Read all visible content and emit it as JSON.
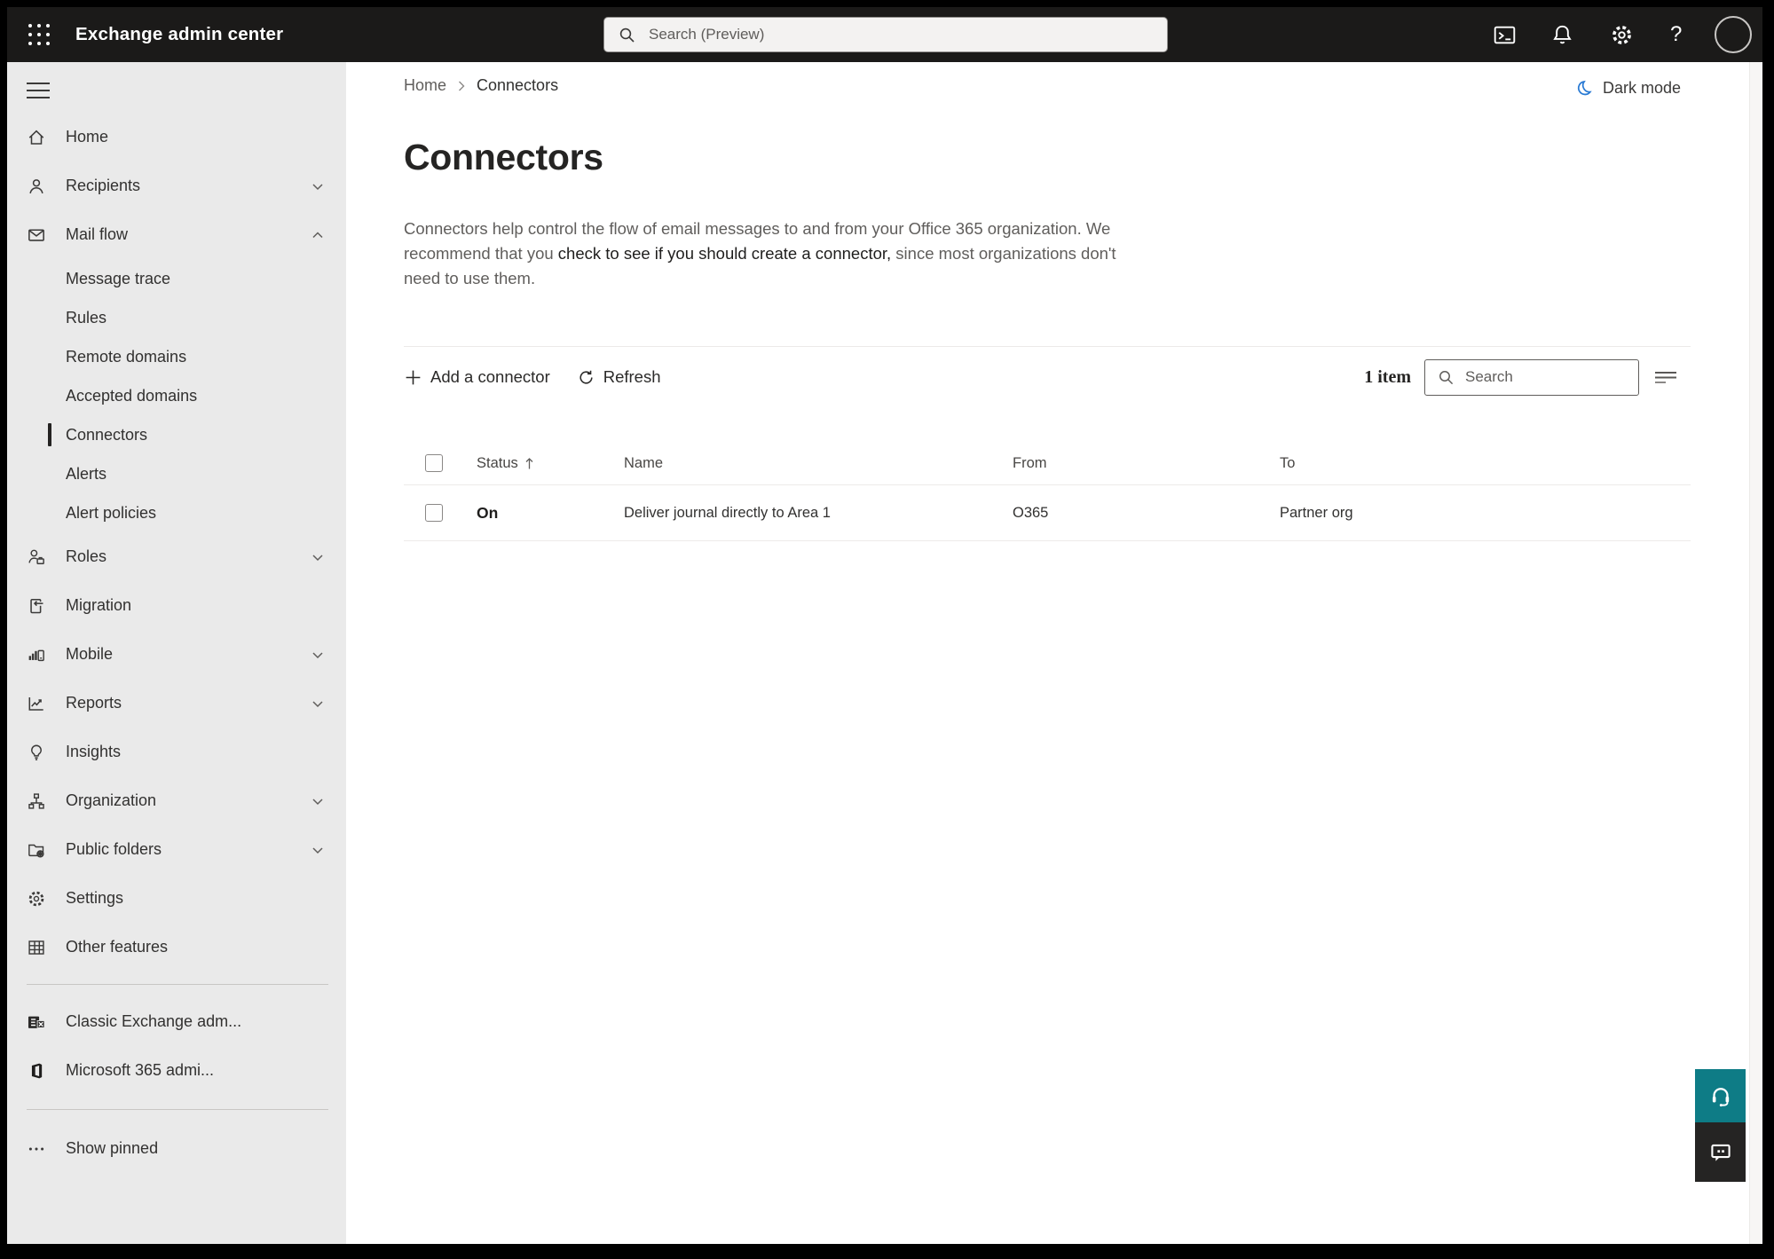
{
  "topbar": {
    "title": "Exchange admin center",
    "search_placeholder": "Search (Preview)"
  },
  "sidebar": {
    "items": [
      {
        "label": "Home",
        "icon": "home"
      },
      {
        "label": "Recipients",
        "icon": "recipients",
        "chevron": "down"
      },
      {
        "label": "Mail flow",
        "icon": "mail-flow",
        "chevron": "up"
      },
      {
        "label": "Message trace",
        "sub": true
      },
      {
        "label": "Rules",
        "sub": true
      },
      {
        "label": "Remote domains",
        "sub": true
      },
      {
        "label": "Accepted domains",
        "sub": true
      },
      {
        "label": "Connectors",
        "sub": true,
        "selected": true
      },
      {
        "label": "Alerts",
        "sub": true
      },
      {
        "label": "Alert policies",
        "sub": true
      },
      {
        "label": "Roles",
        "icon": "roles",
        "chevron": "down"
      },
      {
        "label": "Migration",
        "icon": "migration"
      },
      {
        "label": "Mobile",
        "icon": "mobile",
        "chevron": "down"
      },
      {
        "label": "Reports",
        "icon": "reports",
        "chevron": "down"
      },
      {
        "label": "Insights",
        "icon": "insights"
      },
      {
        "label": "Organization",
        "icon": "organization",
        "chevron": "down"
      },
      {
        "label": "Public folders",
        "icon": "public-folders",
        "chevron": "down"
      },
      {
        "label": "Settings",
        "icon": "settings"
      },
      {
        "label": "Other features",
        "icon": "other-features"
      }
    ],
    "footer_items": [
      {
        "label": "Classic Exchange adm...",
        "icon": "exchange-logo"
      },
      {
        "label": "Microsoft 365 admi...",
        "icon": "microsoft-365-logo"
      }
    ],
    "show_pinned_label": "Show pinned"
  },
  "breadcrumb": {
    "home": "Home",
    "current": "Connectors"
  },
  "dark_mode": {
    "label": "Dark mode"
  },
  "page": {
    "title": "Connectors",
    "description_line1": "Connectors help control the flow of email messages to and from your Office 365 organization. We",
    "description_line2_pre": "recommend that you ",
    "description_link": "check to see if you should create a connector,",
    "description_line2_post": " since most organizations don't",
    "description_line3": "need to use them."
  },
  "toolbar": {
    "add_label": "Add a connector",
    "refresh_label": "Refresh",
    "item_count": "1 item",
    "search_placeholder": "Search"
  },
  "table": {
    "headers": {
      "status": "Status",
      "name": "Name",
      "from": "From",
      "to": "To"
    },
    "rows": [
      {
        "status": "On",
        "name": "Deliver journal directly to Area 1",
        "from": "O365",
        "to": "Partner org"
      }
    ]
  },
  "colors": {
    "topbar_bg": "#1b1a19",
    "sidebar_bg": "#eaeaea",
    "accent_teal": "#0e7c86",
    "feedback_dark": "#252423",
    "moon_blue": "#2b7bd4",
    "text_dark": "#323130",
    "text_gray": "#605e5c"
  }
}
